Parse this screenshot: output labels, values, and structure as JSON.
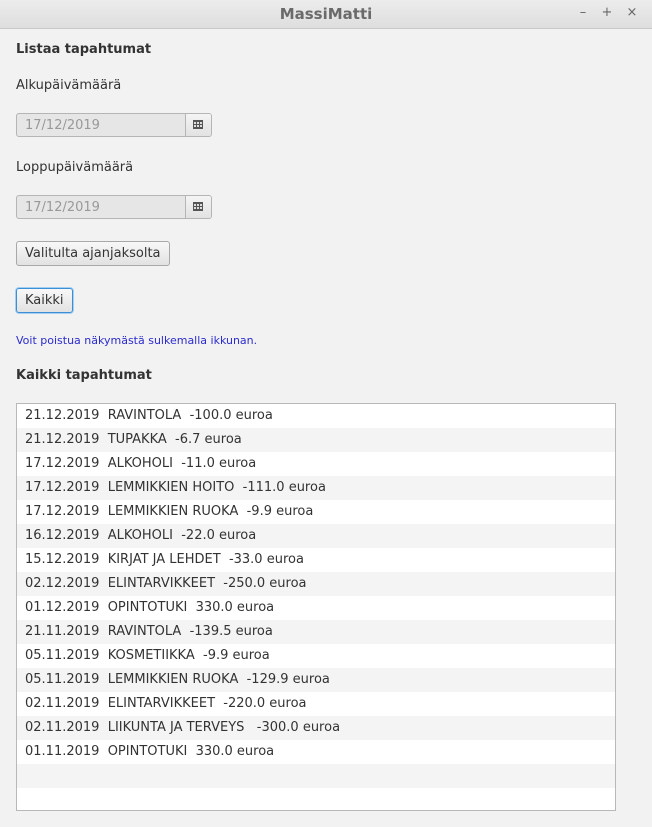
{
  "window": {
    "title": "MassiMatti",
    "controls": [
      "–",
      "+",
      "×"
    ]
  },
  "form": {
    "heading": "Listaa tapahtumat",
    "start_label": "Alkupäivämäärä",
    "start_value": "17/12/2019",
    "end_label": "Loppupäivämäärä",
    "end_value": "17/12/2019",
    "range_button": "Valitulta ajanjaksolta",
    "all_button": "Kaikki",
    "close_note": "Voit poistua näkymästä sulkemalla ikkunan."
  },
  "events": {
    "heading": "Kaikki tapahtumat",
    "items": [
      "21.12.2019  RAVINTOLA  -100.0 euroa",
      "21.12.2019  TUPAKKA  -6.7 euroa",
      "17.12.2019  ALKOHOLI  -11.0 euroa",
      "17.12.2019  LEMMIKKIEN HOITO  -111.0 euroa",
      "17.12.2019  LEMMIKKIEN RUOKA  -9.9 euroa",
      "16.12.2019  ALKOHOLI  -22.0 euroa",
      "15.12.2019  KIRJAT JA LEHDET  -33.0 euroa",
      "02.12.2019  ELINTARVIKKEET  -250.0 euroa",
      "01.12.2019  OPINTOTUKI  330.0 euroa",
      "21.11.2019  RAVINTOLA  -139.5 euroa",
      "05.11.2019  KOSMETIIKKA  -9.9 euroa",
      "05.11.2019  LEMMIKKIEN RUOKA  -129.9 euroa",
      "02.11.2019  ELINTARVIKKEET  -220.0 euroa",
      "02.11.2019  LIIKUNTA JA TERVEYS   -300.0 euroa",
      "01.11.2019  OPINTOTUKI  330.0 euroa"
    ]
  }
}
